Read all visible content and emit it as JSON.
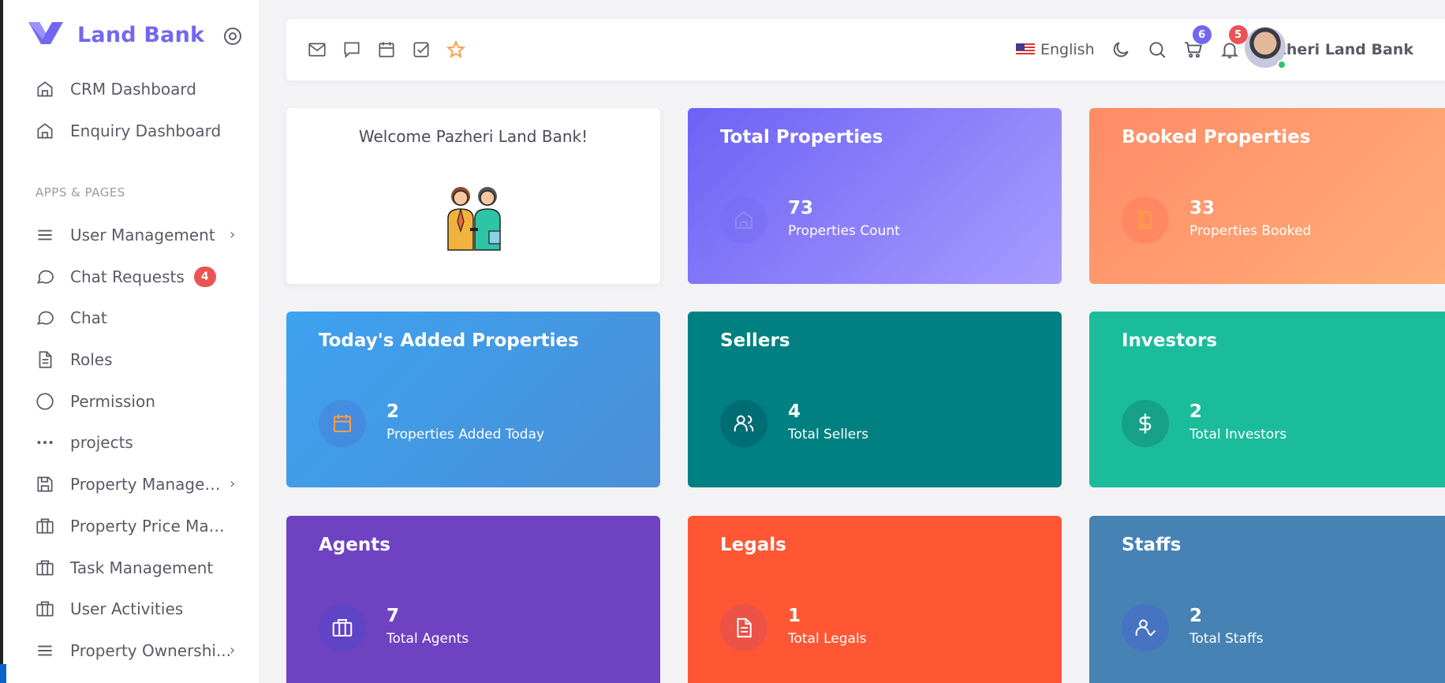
{
  "brand": {
    "name": "Land Bank",
    "accent": "#7367f0"
  },
  "sidebar": {
    "items": [
      {
        "label": "CRM Dashboard",
        "icon": "home-icon"
      },
      {
        "label": "Enquiry Dashboard",
        "icon": "home-icon"
      }
    ],
    "section_title": "APPS & PAGES",
    "app_items": [
      {
        "label": "User Management",
        "icon": "menu-icon",
        "arrow": "›"
      },
      {
        "label": "Chat Requests",
        "icon": "chat-icon",
        "badge": "4"
      },
      {
        "label": "Chat",
        "icon": "chat-icon"
      },
      {
        "label": "Roles",
        "icon": "document-icon"
      },
      {
        "label": "Permission",
        "icon": "circle-icon"
      },
      {
        "label": "projects",
        "icon": "dots-icon"
      },
      {
        "label": "Property Managem...",
        "icon": "save-icon",
        "arrow": "›"
      },
      {
        "label": "Property Price Man...",
        "icon": "briefcase-icon"
      },
      {
        "label": "Task Management",
        "icon": "briefcase-icon"
      },
      {
        "label": "User Activities",
        "icon": "briefcase-icon"
      },
      {
        "label": "Property Ownershi...",
        "icon": "menu-icon",
        "arrow": "›"
      }
    ]
  },
  "topbar": {
    "shortcut_icons": [
      "mail-icon",
      "chat-icon",
      "calendar-icon",
      "checkbox-icon",
      "star-icon"
    ],
    "language": "English",
    "cart_badge": "6",
    "notification_badge": "5",
    "user_name": "Pazheri Land Bank",
    "badge_colors": {
      "cart": "#7367f0",
      "notification": "#ea5455"
    }
  },
  "welcome": {
    "text": "Welcome Pazheri Land Bank!"
  },
  "cards": [
    {
      "title": "Total Properties",
      "value": "73",
      "label": "Properties Count",
      "icon": "home-icon"
    },
    {
      "title": "Booked Properties",
      "value": "33",
      "label": "Properties Booked",
      "icon": "book-icon"
    },
    {
      "title": "Today's Added Properties",
      "value": "2",
      "label": "Properties Added Today",
      "icon": "calendar-icon"
    },
    {
      "title": "Sellers",
      "value": "4",
      "label": "Total Sellers",
      "icon": "users-icon"
    },
    {
      "title": "Investors",
      "value": "2",
      "label": "Total Investors",
      "icon": "dollar-icon"
    },
    {
      "title": "Agents",
      "value": "7",
      "label": "Total Agents",
      "icon": "briefcase-icon"
    },
    {
      "title": "Legals",
      "value": "1",
      "label": "Total Legals",
      "icon": "file-icon"
    },
    {
      "title": "Staffs",
      "value": "2",
      "label": "Total Staffs",
      "icon": "user-check-icon"
    }
  ]
}
